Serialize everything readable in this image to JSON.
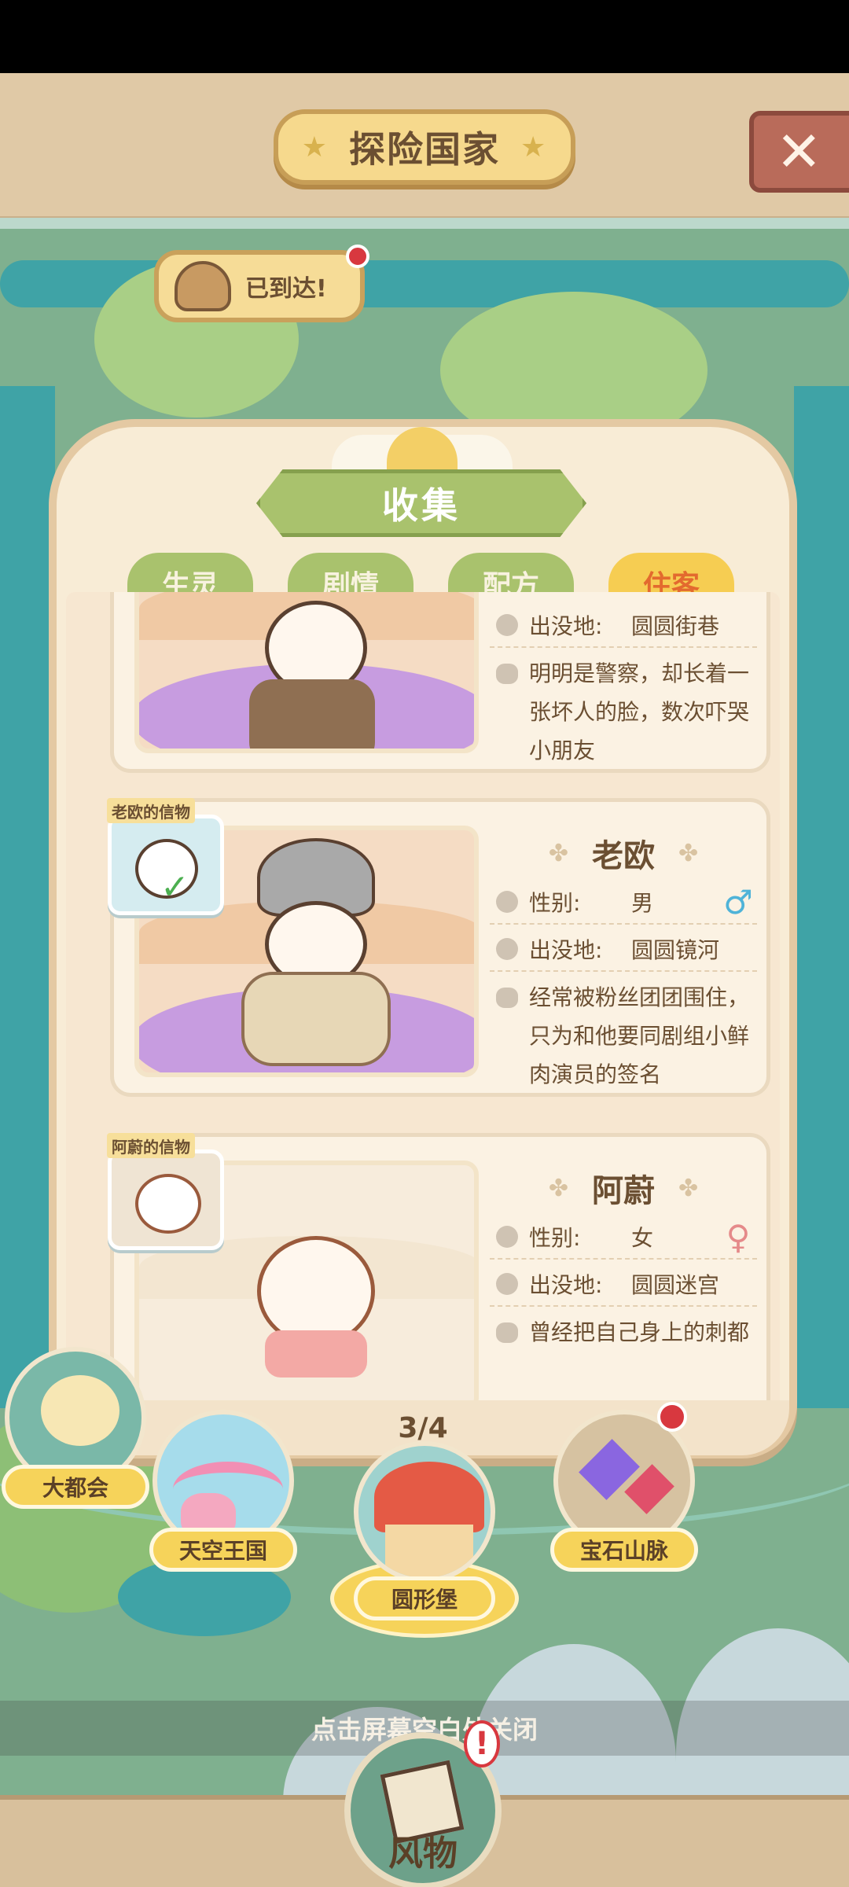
{
  "header": {
    "title": "探险国家",
    "close_icon": "close-x-icon"
  },
  "arrival": {
    "text": "已到达!"
  },
  "panel": {
    "title": "收集",
    "tabs": [
      {
        "label": "生灵",
        "active": false
      },
      {
        "label": "剧情",
        "active": false
      },
      {
        "label": "配方",
        "active": false
      },
      {
        "label": "住客",
        "active": true
      }
    ],
    "residents": [
      {
        "location_label": "出没地:",
        "location": "圆圆街巷",
        "description_lines": [
          "明明是警察，却长着一",
          "张坏人的脸，数次吓哭",
          "小朋友"
        ]
      },
      {
        "token_label": "老欧的信物",
        "name": "老欧",
        "gender_label": "性别:",
        "gender": "男",
        "gender_symbol": "♂",
        "location_label": "出没地:",
        "location": "圆圆镜河",
        "description_lines": [
          "经常被粉丝团团围住，",
          "只为和他要同剧组小鲜",
          "肉演员的签名"
        ]
      },
      {
        "token_label": "阿蔚的信物",
        "name": "阿蔚",
        "gender_label": "性别:",
        "gender": "女",
        "gender_symbol": "♀",
        "location_label": "出没地:",
        "location": "圆圆迷宫",
        "description_lines": [
          "曾经把自己身上的刺都"
        ]
      }
    ],
    "pager": "3/4"
  },
  "locations": [
    {
      "label": "大都会"
    },
    {
      "label": "天空王国"
    },
    {
      "label": "圆形堡"
    },
    {
      "label": "宝石山脉"
    }
  ],
  "hint": "点击屏幕空白处关闭",
  "bottom": {
    "label": "风物",
    "alert": "!"
  },
  "colors": {
    "accent_green": "#a9c26d",
    "active_tab": "#f6cd52",
    "male": "#4fb3d8",
    "female": "#e58a8a",
    "alert_red": "#d8383f"
  }
}
